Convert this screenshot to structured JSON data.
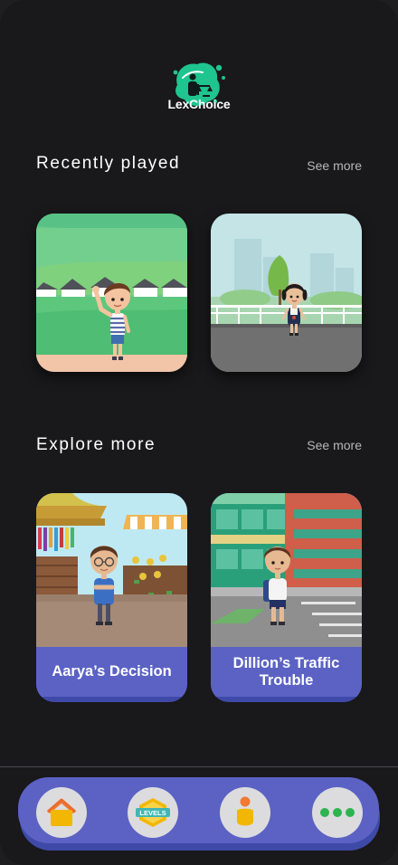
{
  "app": {
    "name": "LexChoice"
  },
  "recently_played": {
    "title": "Recently played",
    "see_more": "See more"
  },
  "explore_more": {
    "title": "Explore more",
    "see_more": "See more",
    "stories": [
      {
        "title": "Aarya’s Decision"
      },
      {
        "title": "Dillion’s Traffic Trouble"
      }
    ]
  },
  "nav": {
    "items": [
      {
        "icon": "home-icon"
      },
      {
        "icon": "levels-icon",
        "badge_text": "LEVELS"
      },
      {
        "icon": "profile-icon"
      },
      {
        "icon": "more-icon"
      }
    ]
  },
  "colors": {
    "background": "#19181a",
    "nav_bar": "#5b62c4",
    "card_label": "#5b62c4",
    "logo_green": "#1fc58e"
  }
}
